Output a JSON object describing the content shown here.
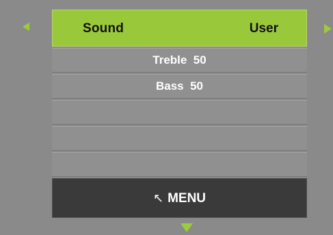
{
  "colors": {
    "background": "#8a8a8a",
    "accent_green": "#99c83b",
    "arrow_green": "#9ccc3c",
    "row_gray": "#909090",
    "menu_bar": "#3a3a3a",
    "text_dark": "#111111",
    "text_light": "#ffffff"
  },
  "header": {
    "title": "Sound",
    "value": "User"
  },
  "rows": [
    {
      "label": "Treble  50"
    },
    {
      "label": "Bass  50"
    },
    {
      "label": ""
    },
    {
      "label": ""
    },
    {
      "label": ""
    }
  ],
  "footer": {
    "icon": "return-arrow-icon",
    "icon_glyph": "↖",
    "label": "MENU"
  },
  "navigation": {
    "left_icon": "triangle-left-icon",
    "right_icon": "triangle-right-icon",
    "down_icon": "triangle-down-icon"
  }
}
